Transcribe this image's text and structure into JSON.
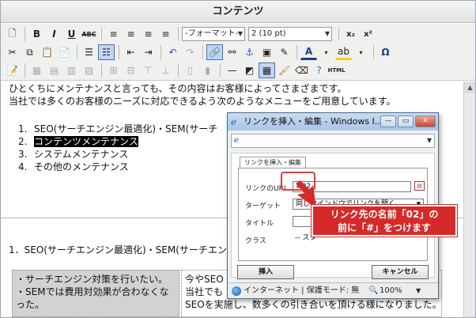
{
  "panel": {
    "title": "コンテンツ"
  },
  "toolbar": {
    "format_select": "-フォーマット-",
    "size_select": "2 (10 pt)",
    "bold": "B",
    "italic": "I",
    "underline": "U",
    "strike": "ABC",
    "subscript": "x₂",
    "superscript": "x²",
    "omega": "Ω",
    "font_color": "A",
    "html": "HTML"
  },
  "editor": {
    "line1": "ひとくちにメンテナンスと言っても、その内容はお客様によってさまざまです。",
    "line2": "当社では多くのお客様のニーズに対応できるよう次のようなメニューをご用意しています。",
    "list": [
      {
        "num": "1.",
        "text": "SEO(サーチエンジン最適化)・SEM(サーチ"
      },
      {
        "num": "2.",
        "text": "コンテンツメンテナンス"
      },
      {
        "num": "3.",
        "text": "システムメンテナンス"
      },
      {
        "num": "4.",
        "text": "その他のメンテナンス"
      }
    ],
    "section_heading": "1．SEO(サーチエンジン最適化)・SEM(サーチエン",
    "left_box": [
      "・サーチエンジン対策を行いたい。",
      "・SEMでは費用対効果が合わなくな",
      "った。"
    ],
    "right_box": [
      "今やSEO",
      "当社でも",
      "SEOを実施し、数多くの引き合いを頂ける様になりました。"
    ]
  },
  "dialog": {
    "title": "リンクを挿入・編集 - Windows I...",
    "tab_label": "リンクを挿入・編集",
    "url_label": "リンクのURL",
    "url_value": "#02",
    "target_label": "ターゲット",
    "target_value": "同じウインドウでリンクを開く",
    "title_label": "タイトル",
    "class_label": "クラス",
    "class_value": "-- スタ",
    "insert_button": "挿入",
    "cancel_button": "キャンセル",
    "status_text": "インターネット | 保護モード: 無",
    "zoom": "100%"
  },
  "annotation": {
    "line1": "リンク先の名前「02」の",
    "line2": "前に「#」をつけます"
  }
}
